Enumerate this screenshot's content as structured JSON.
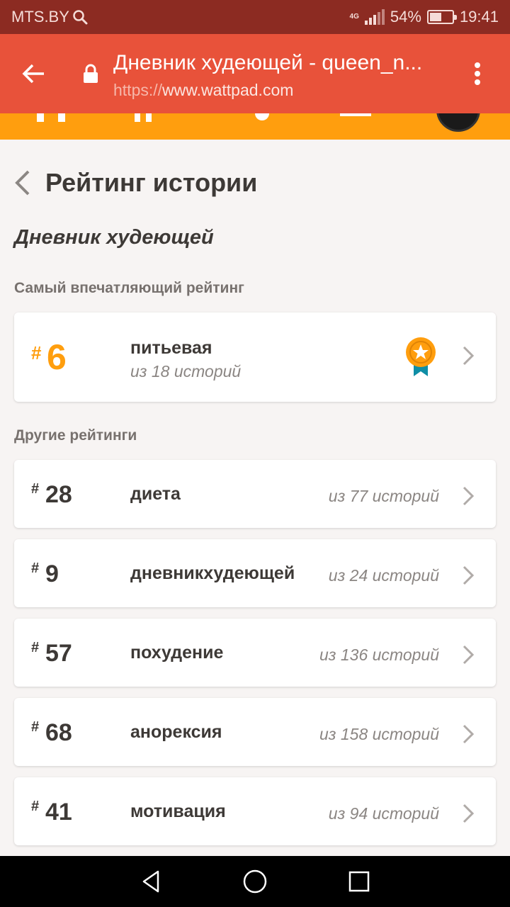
{
  "status_bar": {
    "carrier": "MTS.BY",
    "network": "4G",
    "battery_percent": "54%",
    "battery_level": 0.54,
    "time": "19:41",
    "icons": [
      "search-icon",
      "signal-icon",
      "battery-icon"
    ]
  },
  "browser": {
    "page_title": "Дневник худеющей - queen_n...",
    "url_scheme": "https://",
    "url_host": "www.wattpad.com",
    "icons": [
      "back-arrow-icon",
      "lock-icon",
      "more-vert-icon"
    ],
    "toolbar_color": "#e8523a"
  },
  "site_nav": {
    "color": "#ff9e0e"
  },
  "page": {
    "title": "Рейтинг истории",
    "story_title": "Дневник худеющей",
    "featured_label": "Самый впечатляющий рейтинг",
    "others_label": "Другие рейтинги"
  },
  "featured": {
    "hash": "#",
    "rank": "6",
    "tag": "питьевая",
    "of_text": "из 18 историй",
    "icon": "award-badge-icon",
    "accent": "#ff9e0e"
  },
  "rankings": [
    {
      "hash": "#",
      "rank": "28",
      "tag": "диета",
      "of_text": "из 77 историй"
    },
    {
      "hash": "#",
      "rank": "9",
      "tag": "дневникхудеющей",
      "of_text": "из 24 историй"
    },
    {
      "hash": "#",
      "rank": "57",
      "tag": "похудение",
      "of_text": "из 136 историй"
    },
    {
      "hash": "#",
      "rank": "68",
      "tag": "анорексия",
      "of_text": "из 158 историй"
    },
    {
      "hash": "#",
      "rank": "41",
      "tag": "мотивация",
      "of_text": "из 94 историй"
    }
  ],
  "system_nav": {
    "icons": [
      "back-triangle-icon",
      "home-circle-icon",
      "recents-square-icon"
    ]
  }
}
